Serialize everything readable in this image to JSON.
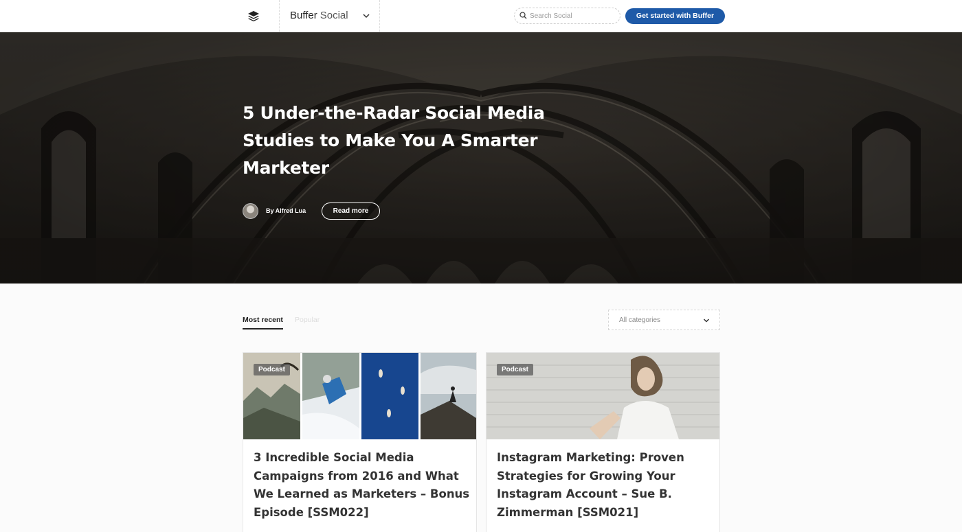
{
  "header": {
    "logo_icon": "buffer-layers-icon",
    "brand_name": "Buffer",
    "brand_suffix": "Social",
    "search_placeholder": "Search Social",
    "cta_label": "Get started with Buffer"
  },
  "hero": {
    "title": "5 Under-the-Radar Social Media Studies to Make You A Smarter Marketer",
    "byline": "By Alfred Lua",
    "read_more_label": "Read more"
  },
  "tabs": [
    {
      "label": "Most recent",
      "active": true
    },
    {
      "label": "Popular",
      "active": false
    }
  ],
  "filter": {
    "selected": "All categories"
  },
  "posts": [
    {
      "badge": "Podcast",
      "title": "3 Incredible Social Media Campaigns from 2016 and What We Learned as Marketers – Bonus Episode [SSM022]"
    },
    {
      "badge": "Podcast",
      "title": "Instagram Marketing: Proven Strategies for Growing Your Instagram Account – Sue B. Zimmerman [SSM021]"
    }
  ],
  "colors": {
    "accent": "#1e5aa8",
    "hero_overlay": "#2e2a25"
  }
}
